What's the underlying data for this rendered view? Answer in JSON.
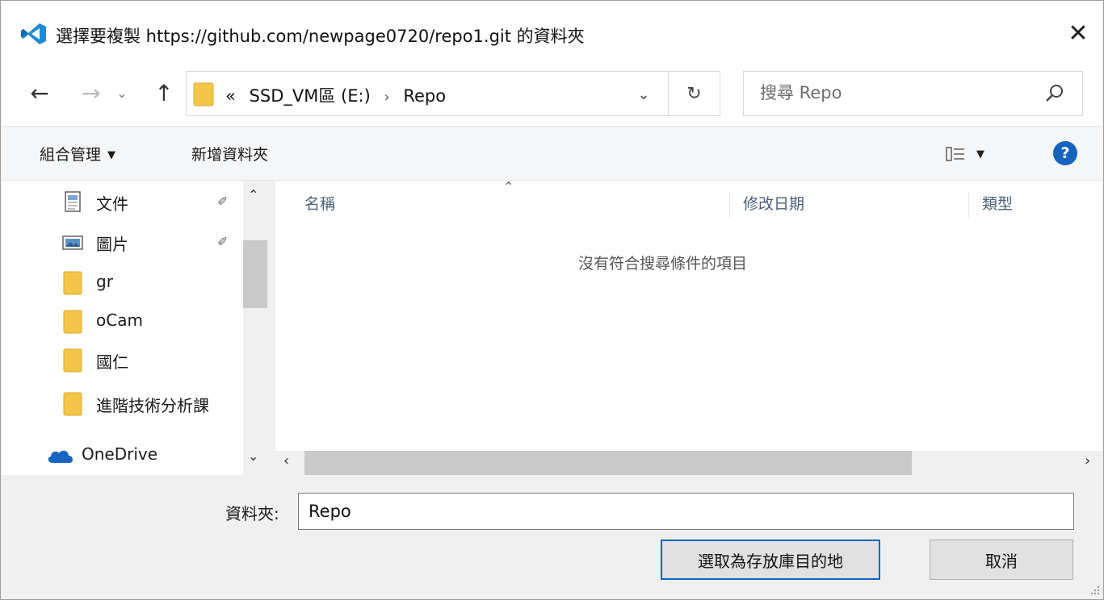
{
  "window": {
    "title": "選擇要複製 https://github.com/newpage0720/repo1.git 的資料夾",
    "close_label": "✕"
  },
  "nav": {
    "back_icon": "←",
    "forward_icon": "→",
    "recent_icon": "⌄",
    "up_icon": "↑",
    "address": {
      "prefix": "«",
      "drive": "SSD_VM區 (E:)",
      "separator": "›",
      "folder": "Repo",
      "dropdown_icon": "⌄",
      "refresh_icon": "↻"
    },
    "search": {
      "placeholder": "搜尋 Repo"
    }
  },
  "toolbar": {
    "organize_label": "組合管理",
    "organize_caret": "▼",
    "new_folder_label": "新增資料夾",
    "view_caret": "▼",
    "help_label": "?"
  },
  "sidebar": {
    "items": [
      {
        "label": "文件",
        "icon": "document-icon",
        "pinned": true
      },
      {
        "label": "圖片",
        "icon": "pictures-icon",
        "pinned": true
      },
      {
        "label": "gr",
        "icon": "folder-icon"
      },
      {
        "label": "oCam",
        "icon": "folder-icon"
      },
      {
        "label": "國仁",
        "icon": "folder-icon"
      },
      {
        "label": "進階技術分析課",
        "icon": "folder-icon"
      },
      {
        "label": "OneDrive",
        "icon": "onedrive-icon"
      }
    ],
    "pin_glyph": "✐",
    "scroll_up": "⌃",
    "scroll_down": "⌄"
  },
  "filelist": {
    "sort_arrow": "⌃",
    "columns": [
      "名稱",
      "修改日期",
      "類型"
    ],
    "empty_message": "沒有符合搜尋條件的項目",
    "scroll_left": "‹",
    "scroll_right": "›"
  },
  "footer": {
    "folder_label": "資料夾:",
    "folder_value": "Repo",
    "select_button": "選取為存放庫目的地",
    "cancel_button": "取消"
  },
  "colors": {
    "accent": "#0a64c8",
    "folder": "#f3c64a",
    "help": "#1565c0",
    "vscode": "#1f8ad2"
  }
}
